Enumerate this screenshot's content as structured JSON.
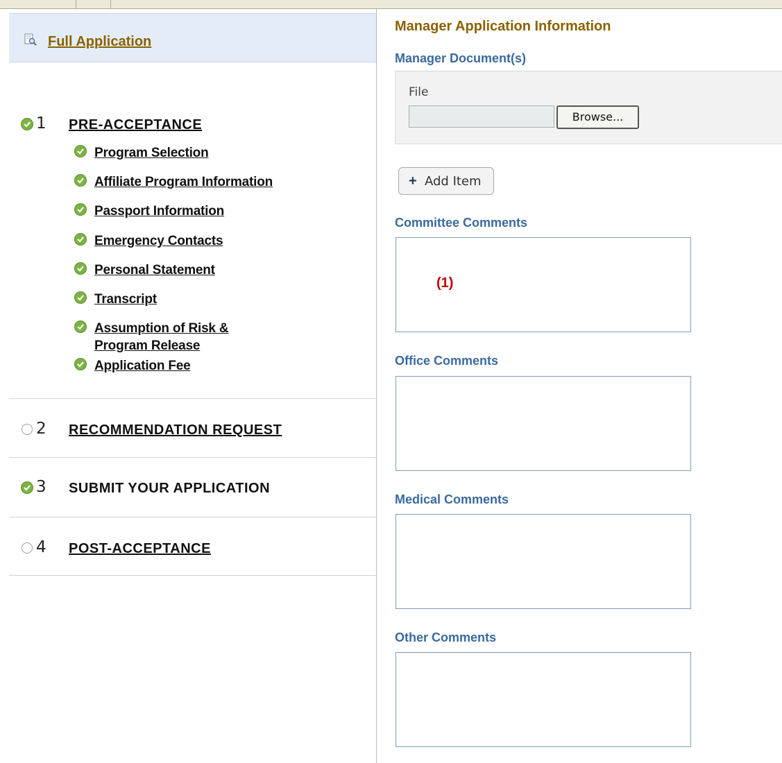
{
  "sidebar": {
    "full_application_label": "Full Application",
    "steps": [
      {
        "number": "1",
        "label": "PRE-ACCEPTANCE",
        "complete": true,
        "items": [
          {
            "label": "Program Selection"
          },
          {
            "label": "Affiliate Program Information"
          },
          {
            "label": "Passport Information"
          },
          {
            "label": "Emergency Contacts"
          },
          {
            "label": "Personal Statement"
          },
          {
            "label": "Transcript"
          },
          {
            "label": "Assumption of Risk &",
            "label2": "Program Release"
          },
          {
            "label": "Application Fee"
          }
        ]
      },
      {
        "number": "2",
        "label": "RECOMMENDATION REQUEST",
        "complete": false
      },
      {
        "number": "3",
        "label": "SUBMIT YOUR APPLICATION",
        "complete": true
      },
      {
        "number": "4",
        "label": "POST-ACCEPTANCE",
        "complete": false
      }
    ]
  },
  "main": {
    "section_title": "Manager Application Information",
    "documents_label": "Manager Document(s)",
    "file_label": "File",
    "browse_label": "Browse...",
    "add_item_label": "Add Item",
    "comments": [
      {
        "label": "Committee Comments"
      },
      {
        "label": "Office Comments"
      },
      {
        "label": "Medical Comments"
      },
      {
        "label": "Other Comments"
      }
    ],
    "annotation_marker": "(1)"
  },
  "colors": {
    "accent_gold": "#8a6200",
    "label_blue": "#3a6a9e",
    "check_green": "#7cb342",
    "highlight_bg": "#e4edf7"
  }
}
